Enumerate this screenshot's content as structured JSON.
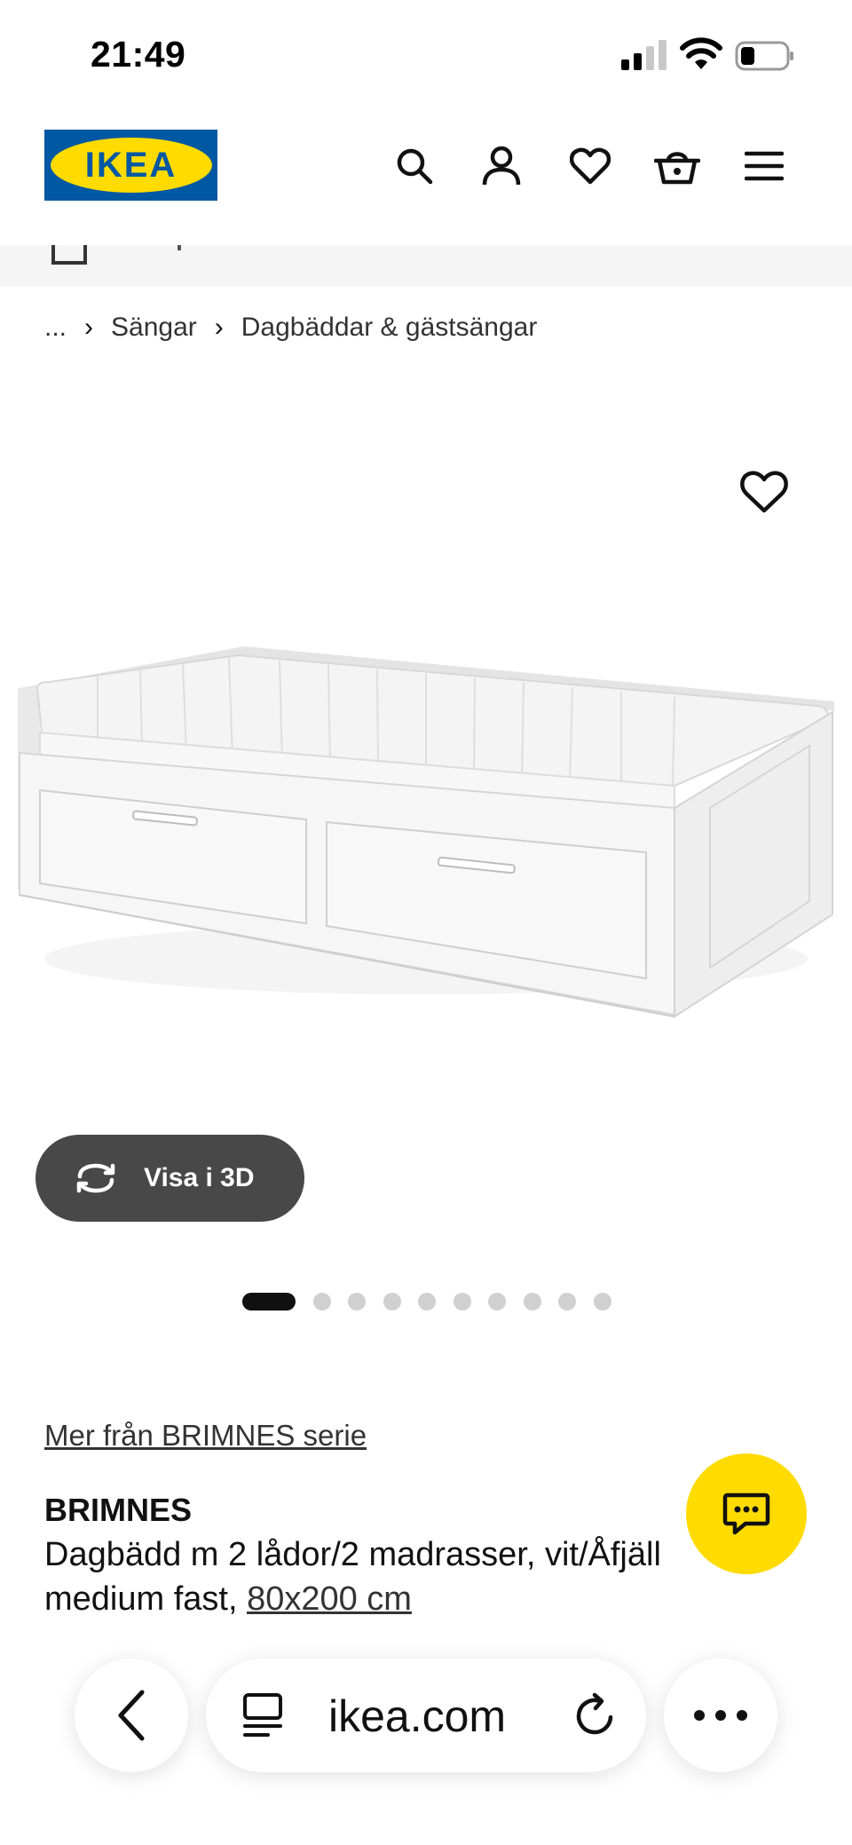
{
  "status_bar": {
    "time": "21:49"
  },
  "header": {
    "logo_text": "IKEA"
  },
  "breadcrumb": {
    "ellipsis": "...",
    "items": [
      "Sängar",
      "Dagbäddar & gästsängar"
    ]
  },
  "gallery": {
    "view_3d_label": "Visa i 3D",
    "dot_count": 10,
    "active_dot": 0
  },
  "product": {
    "series_link": "Mer från BRIMNES serie",
    "name": "BRIMNES",
    "description": "Dagbädd m 2 lådor/2 madrasser, vit/Åfjäll",
    "description_line2": "medium fast, ",
    "size": "80x200 cm"
  },
  "browser": {
    "url": "ikea.com"
  },
  "colors": {
    "brand_blue": "#0058a3",
    "brand_yellow": "#ffdb00",
    "button_dark": "#484848"
  }
}
